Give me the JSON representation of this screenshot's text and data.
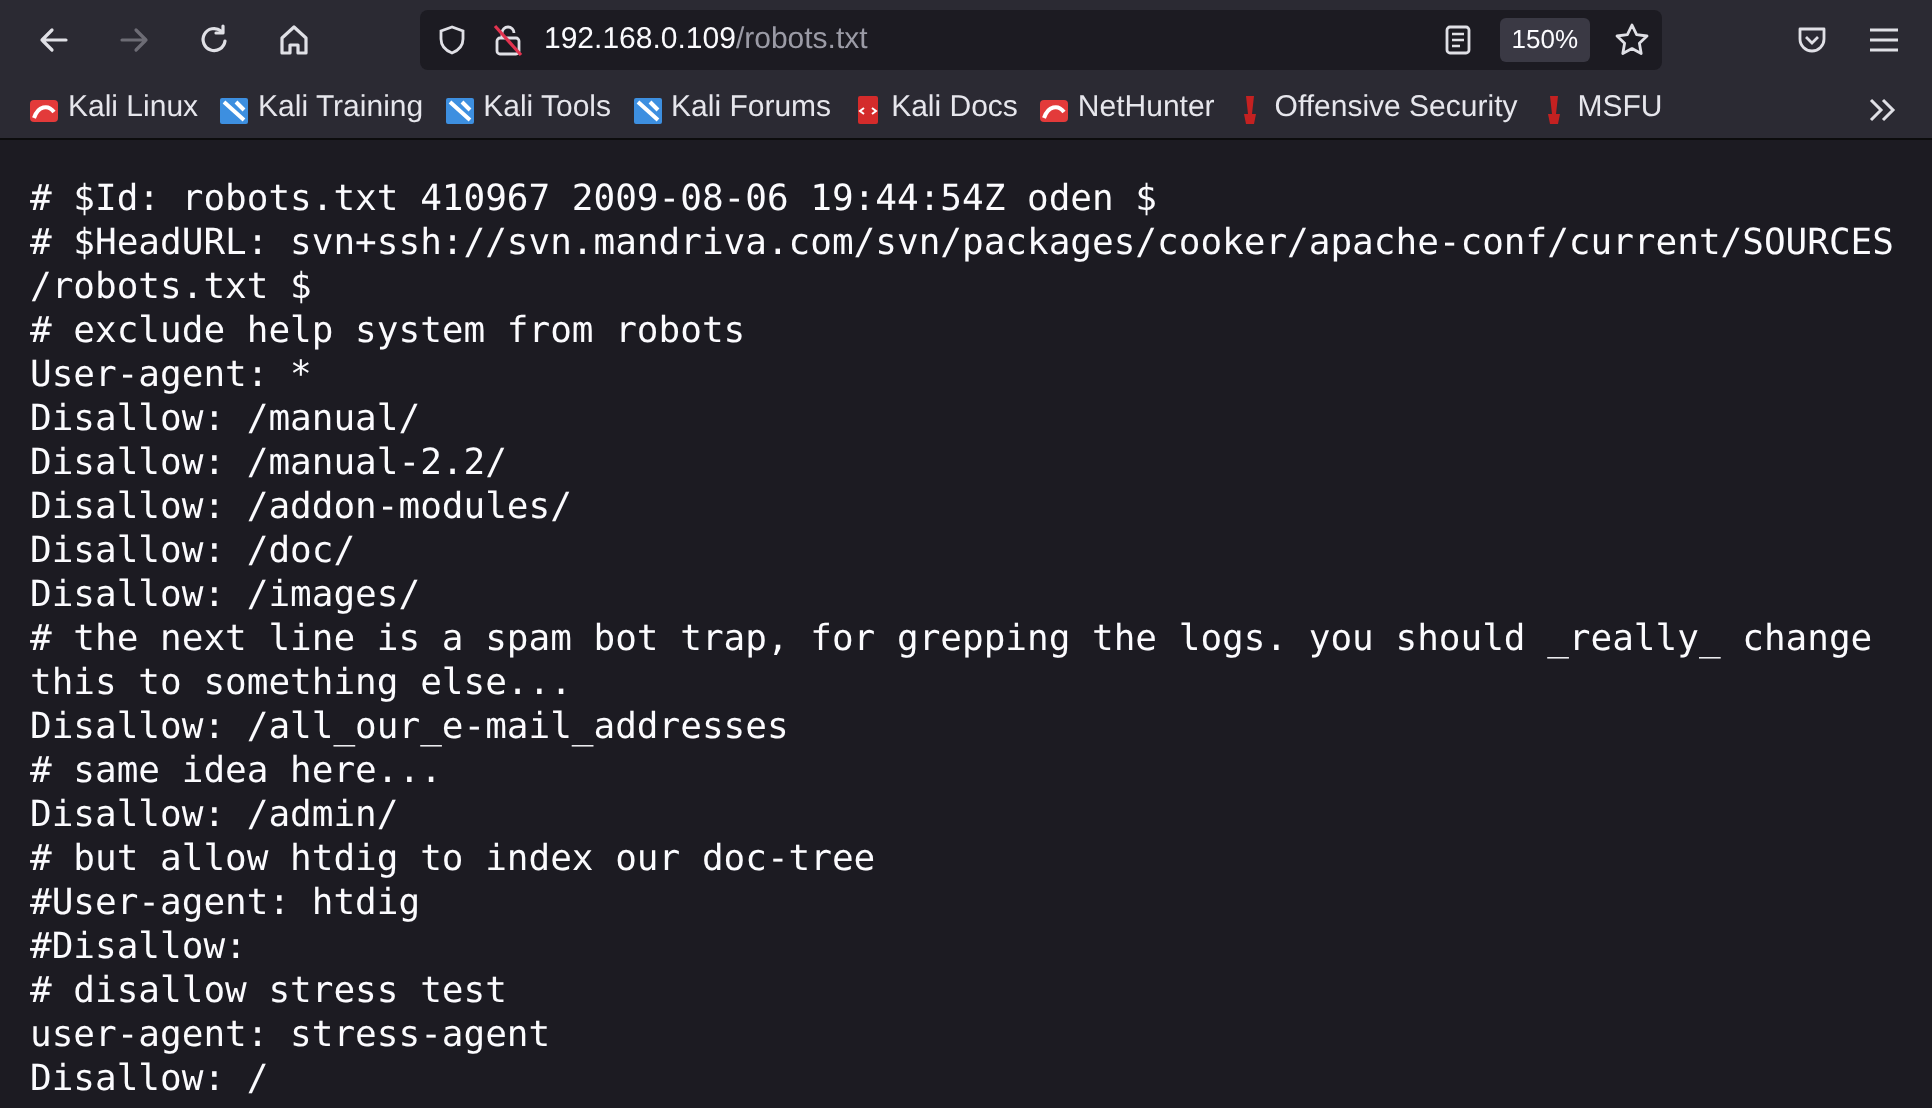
{
  "toolbar": {
    "nav_buttons": [
      {
        "kind": "back",
        "disabled": false
      },
      {
        "kind": "forward",
        "disabled": true
      },
      {
        "kind": "reload",
        "disabled": false
      },
      {
        "kind": "home",
        "disabled": false
      }
    ],
    "address_bar": {
      "host": "192.168.0.109",
      "path": "/robots.txt",
      "zoom": "150%"
    }
  },
  "bookmarks": [
    {
      "label": "Kali Linux",
      "kind": "kali"
    },
    {
      "label": "Kali Training",
      "kind": "kali-tool"
    },
    {
      "label": "Kali Tools",
      "kind": "kali-tool"
    },
    {
      "label": "Kali Forums",
      "kind": "kali-tool"
    },
    {
      "label": "Kali Docs",
      "kind": "docs"
    },
    {
      "label": "NetHunter",
      "kind": "kali"
    },
    {
      "label": "Offensive Security",
      "kind": "offsec"
    },
    {
      "label": "MSFU",
      "kind": "offsec"
    }
  ],
  "document": {
    "lines": [
      "# $Id: robots.txt 410967 2009-08-06 19:44:54Z oden $",
      "# $HeadURL: svn+ssh://svn.mandriva.com/svn/packages/cooker/apache-conf/current/SOURCES",
      "/robots.txt $",
      "# exclude help system from robots",
      "User-agent: *",
      "Disallow: /manual/",
      "Disallow: /manual-2.2/",
      "Disallow: /addon-modules/",
      "Disallow: /doc/",
      "Disallow: /images/",
      "# the next line is a spam bot trap, for grepping the logs. you should _really_ change",
      "this to something else...",
      "Disallow: /all_our_e-mail_addresses",
      "# same idea here...",
      "Disallow: /admin/",
      "# but allow htdig to index our doc-tree",
      "#User-agent: htdig",
      "#Disallow:",
      "# disallow stress test",
      "user-agent: stress-agent",
      "Disallow: /"
    ]
  }
}
